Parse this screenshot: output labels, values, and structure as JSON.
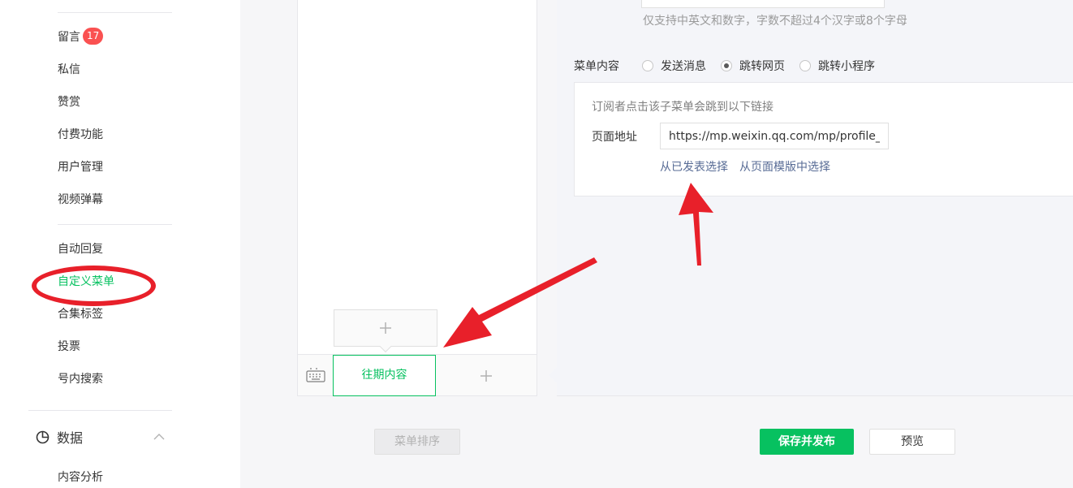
{
  "sidebar": {
    "items": [
      {
        "label": "留言",
        "badge": "17"
      },
      {
        "label": "私信"
      },
      {
        "label": "赞赏"
      },
      {
        "label": "付费功能"
      },
      {
        "label": "用户管理"
      },
      {
        "label": "视频弹幕"
      },
      {
        "label": "自动回复"
      },
      {
        "label": "自定义菜单",
        "active": true
      },
      {
        "label": "合集标签"
      },
      {
        "label": "投票"
      },
      {
        "label": "号内搜索"
      }
    ],
    "group": {
      "label": "数据",
      "icon": "pie-chart-icon",
      "expanded": true
    },
    "sub_items": [
      {
        "label": "内容分析"
      }
    ]
  },
  "phone": {
    "menu_button": "往期内容",
    "add_sub_icon": "plus-icon",
    "add_main_icon": "plus-icon",
    "keyboard_icon": "keyboard-icon"
  },
  "editor": {
    "name_hint": "仅支持中英文和数字，字数不超过4个汉字或8个字母",
    "content_label": "菜单内容",
    "options": [
      {
        "label": "发送消息",
        "checked": false
      },
      {
        "label": "跳转网页",
        "checked": true
      },
      {
        "label": "跳转小程序",
        "checked": false
      }
    ],
    "url_card": {
      "hint": "订阅者点击该子菜单会跳到以下链接",
      "address_label": "页面地址",
      "url_value": "https://mp.weixin.qq.com/mp/profile_e",
      "link_published": "从已发表选择",
      "link_template": "从页面模版中选择"
    }
  },
  "footer": {
    "sort_label": "菜单排序",
    "save_label": "保存并发布",
    "preview_label": "预览"
  },
  "colors": {
    "accent": "#07c160",
    "badge": "#fa5151",
    "link": "#576b95",
    "annotation": "#e8202a"
  }
}
